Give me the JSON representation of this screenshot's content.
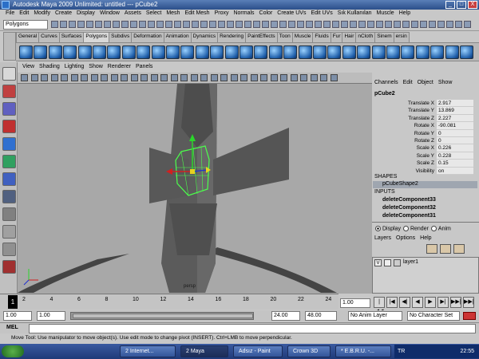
{
  "window": {
    "title": "Autodesk Maya 2009 Unlimited: untitled   ---   pCube2",
    "minimize": "_",
    "maximize": "□",
    "close": "X"
  },
  "menubar": [
    "File",
    "Edit",
    "Modify",
    "Create",
    "Display",
    "Window",
    "Assets",
    "Select",
    "Mesh",
    "Edit Mesh",
    "Proxy",
    "Normals",
    "Color",
    "Create UVs",
    "Edit UVs",
    "Sık Kullanılan",
    "Muscle",
    "Help"
  ],
  "statusline": {
    "menuset": "Polygons"
  },
  "shelf": {
    "tabs": [
      "General",
      "Curves",
      "Surfaces",
      "Polygons",
      "Subdivs",
      "Deformation",
      "Animation",
      "Dynamics",
      "Rendering",
      "PaintEffects",
      "Toon",
      "Muscle",
      "Fluids",
      "Fur",
      "Hair",
      "nCloth",
      "Sinem",
      "ersin"
    ],
    "active_tab": "Polygons"
  },
  "viewport": {
    "menu": [
      "View",
      "Shading",
      "Lighting",
      "Show",
      "Renderer",
      "Panels"
    ],
    "axis_label": "persp"
  },
  "channelbox": {
    "menu": [
      "Channels",
      "Edit",
      "Object",
      "Show"
    ],
    "object_name": "pCube2",
    "attributes": [
      {
        "name": "Translate X",
        "value": "2.917"
      },
      {
        "name": "Translate Y",
        "value": "13.869"
      },
      {
        "name": "Translate Z",
        "value": "2.227"
      },
      {
        "name": "Rotate X",
        "value": "-90.081"
      },
      {
        "name": "Rotate Y",
        "value": "0"
      },
      {
        "name": "Rotate Z",
        "value": "0"
      },
      {
        "name": "Scale X",
        "value": "0.226"
      },
      {
        "name": "Scale Y",
        "value": "0.228"
      },
      {
        "name": "Scale Z",
        "value": "0.15"
      },
      {
        "name": "Visibility",
        "value": "on"
      }
    ],
    "shapes_header": "SHAPES",
    "shape_item": "pCubeShape2",
    "inputs_header": "INPUTS",
    "inputs": [
      "deleteComponent33",
      "deleteComponent32",
      "deleteComponent31"
    ]
  },
  "layereditor": {
    "modes": [
      "Display",
      "Render",
      "Anim"
    ],
    "active_mode": "Display",
    "menu": [
      "Layers",
      "Options",
      "Help"
    ],
    "layer": {
      "visible": "V",
      "name": "layer1"
    }
  },
  "timeline": {
    "current_frame": "1",
    "ticks": [
      "2",
      "4",
      "6",
      "8",
      "10",
      "12",
      "14",
      "16",
      "18",
      "20",
      "22",
      "24"
    ],
    "current_field": "1.00",
    "playback_buttons": [
      "|◀◀",
      "|◀",
      "◀|",
      "◀",
      "▶",
      "▶|",
      "▶▶|",
      "▶▶|"
    ]
  },
  "range": {
    "start": "1.00",
    "playback_start": "1.00",
    "playback_end": "24.00",
    "end": "48.00",
    "anim_layer": "No Anim Layer",
    "character_set": "No Character Set"
  },
  "mel": {
    "label": "MEL"
  },
  "helpline": "Move Tool: Use manipulator to move object(s). Use edit mode to change pivot (INSERT).  Ctrl+LMB to move perpendicular.",
  "taskbar": {
    "items": [
      "2 Internet...",
      "2 Maya",
      "Adsız - Paint",
      "Crown 3D",
      "* E.B.R.U. -..."
    ],
    "lang": "TR",
    "time": "22:55"
  }
}
